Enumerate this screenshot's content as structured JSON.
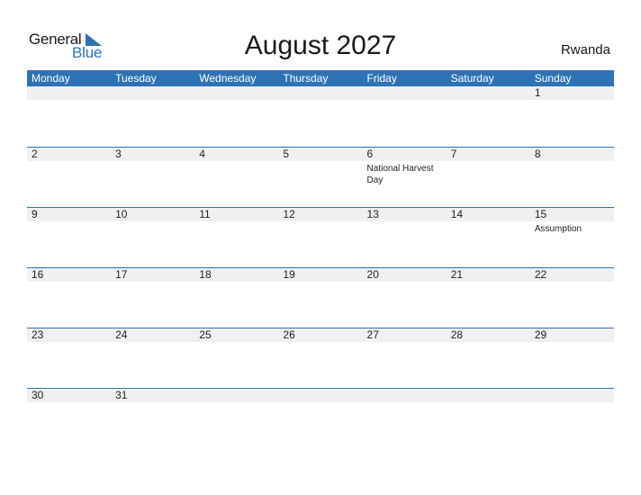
{
  "logo": {
    "line1": "General",
    "line2": "Blue"
  },
  "title": "August 2027",
  "country": "Rwanda",
  "days": [
    "Monday",
    "Tuesday",
    "Wednesday",
    "Thursday",
    "Friday",
    "Saturday",
    "Sunday"
  ],
  "weeks": [
    [
      {
        "day": ""
      },
      {
        "day": ""
      },
      {
        "day": ""
      },
      {
        "day": ""
      },
      {
        "day": ""
      },
      {
        "day": ""
      },
      {
        "day": "1"
      }
    ],
    [
      {
        "day": "2"
      },
      {
        "day": "3"
      },
      {
        "day": "4"
      },
      {
        "day": "5"
      },
      {
        "day": "6",
        "event": "National Harvest Day"
      },
      {
        "day": "7"
      },
      {
        "day": "8"
      }
    ],
    [
      {
        "day": "9"
      },
      {
        "day": "10"
      },
      {
        "day": "11"
      },
      {
        "day": "12"
      },
      {
        "day": "13"
      },
      {
        "day": "14"
      },
      {
        "day": "15",
        "event": "Assumption"
      }
    ],
    [
      {
        "day": "16"
      },
      {
        "day": "17"
      },
      {
        "day": "18"
      },
      {
        "day": "19"
      },
      {
        "day": "20"
      },
      {
        "day": "21"
      },
      {
        "day": "22"
      }
    ],
    [
      {
        "day": "23"
      },
      {
        "day": "24"
      },
      {
        "day": "25"
      },
      {
        "day": "26"
      },
      {
        "day": "27"
      },
      {
        "day": "28"
      },
      {
        "day": "29"
      }
    ],
    [
      {
        "day": "30"
      },
      {
        "day": "31"
      },
      {
        "day": ""
      },
      {
        "day": ""
      },
      {
        "day": ""
      },
      {
        "day": ""
      },
      {
        "day": ""
      }
    ]
  ],
  "colors": {
    "accent": "#2f72b3",
    "band": "#f0f0f0"
  }
}
